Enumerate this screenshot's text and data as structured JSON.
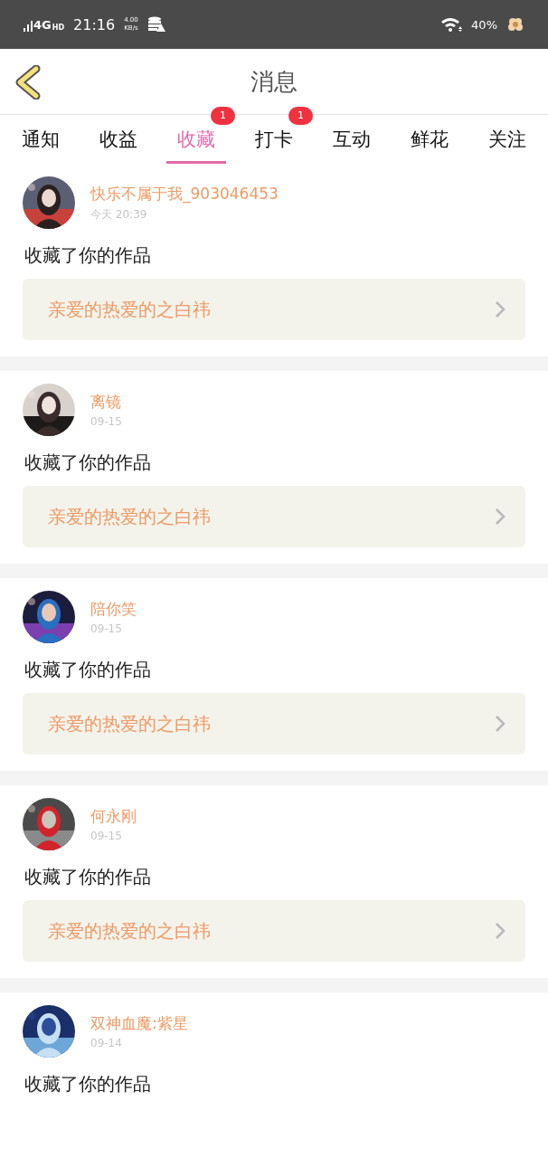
{
  "status_bar": {
    "network": "4G",
    "network_badge": "HD",
    "time": "21:16",
    "speed_value": "4.00",
    "speed_unit": "KB/s",
    "battery": "40%"
  },
  "header": {
    "title": "消息"
  },
  "tabs": [
    {
      "label": "通知",
      "selected": false
    },
    {
      "label": "收益",
      "selected": false
    },
    {
      "label": "收藏",
      "selected": true,
      "badge": "1"
    },
    {
      "label": "打卡",
      "selected": false,
      "badge": "1"
    },
    {
      "label": "互动",
      "selected": false
    },
    {
      "label": "鲜花",
      "selected": false
    },
    {
      "label": "关注",
      "selected": false
    }
  ],
  "messages": [
    {
      "user": "快乐不属于我_903046453",
      "time": "今天 20:39",
      "action": "收藏了你的作品",
      "work": "亲爱的热爱的之白祎"
    },
    {
      "user": "离镜",
      "time": "09-15",
      "action": "收藏了你的作品",
      "work": "亲爱的热爱的之白祎"
    },
    {
      "user": "陪你笑",
      "time": "09-15",
      "action": "收藏了你的作品",
      "work": "亲爱的热爱的之白祎"
    },
    {
      "user": "何永刚",
      "time": "09-15",
      "action": "收藏了你的作品",
      "work": "亲爱的热爱的之白祎"
    },
    {
      "user": "双神血魔:紫星",
      "time": "09-14",
      "action": "收藏了你的作品"
    }
  ]
}
